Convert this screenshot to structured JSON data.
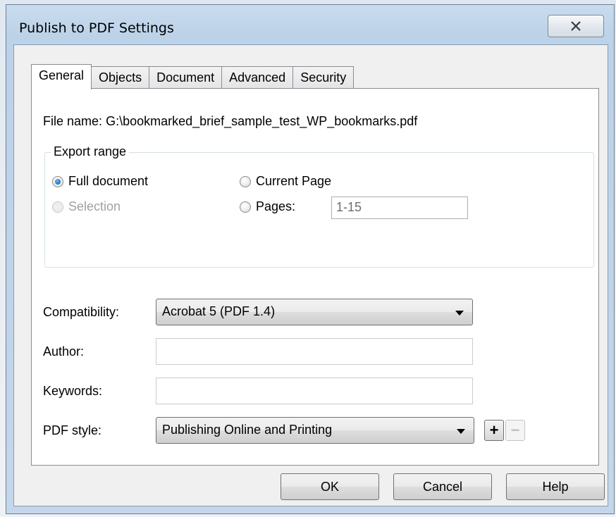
{
  "window": {
    "title": "Publish to PDF Settings"
  },
  "tabs": [
    {
      "label": "General",
      "active": true
    },
    {
      "label": "Objects",
      "active": false
    },
    {
      "label": "Document",
      "active": false
    },
    {
      "label": "Advanced",
      "active": false
    },
    {
      "label": "Security",
      "active": false
    }
  ],
  "general": {
    "file_name_label": "File name:",
    "file_name_value": "G:\\bookmarked_brief_sample_test_WP_bookmarks.pdf",
    "export_range": {
      "legend": "Export range",
      "full_document": "Full document",
      "current_page": "Current Page",
      "selection": "Selection",
      "pages": "Pages:",
      "pages_value": "1-15",
      "selected": "full_document"
    },
    "compatibility_label": "Compatibility:",
    "compatibility_value": "Acrobat 5 (PDF 1.4)",
    "author_label": "Author:",
    "author_value": "",
    "keywords_label": "Keywords:",
    "keywords_value": "",
    "pdf_style_label": "PDF style:",
    "pdf_style_value": "Publishing Online and Printing",
    "add_style_glyph": "+",
    "remove_style_glyph": "−"
  },
  "buttons": {
    "ok": "OK",
    "cancel": "Cancel",
    "help": "Help"
  },
  "icons": {
    "close": "close-icon",
    "dropdown": "chevron-down-icon"
  }
}
